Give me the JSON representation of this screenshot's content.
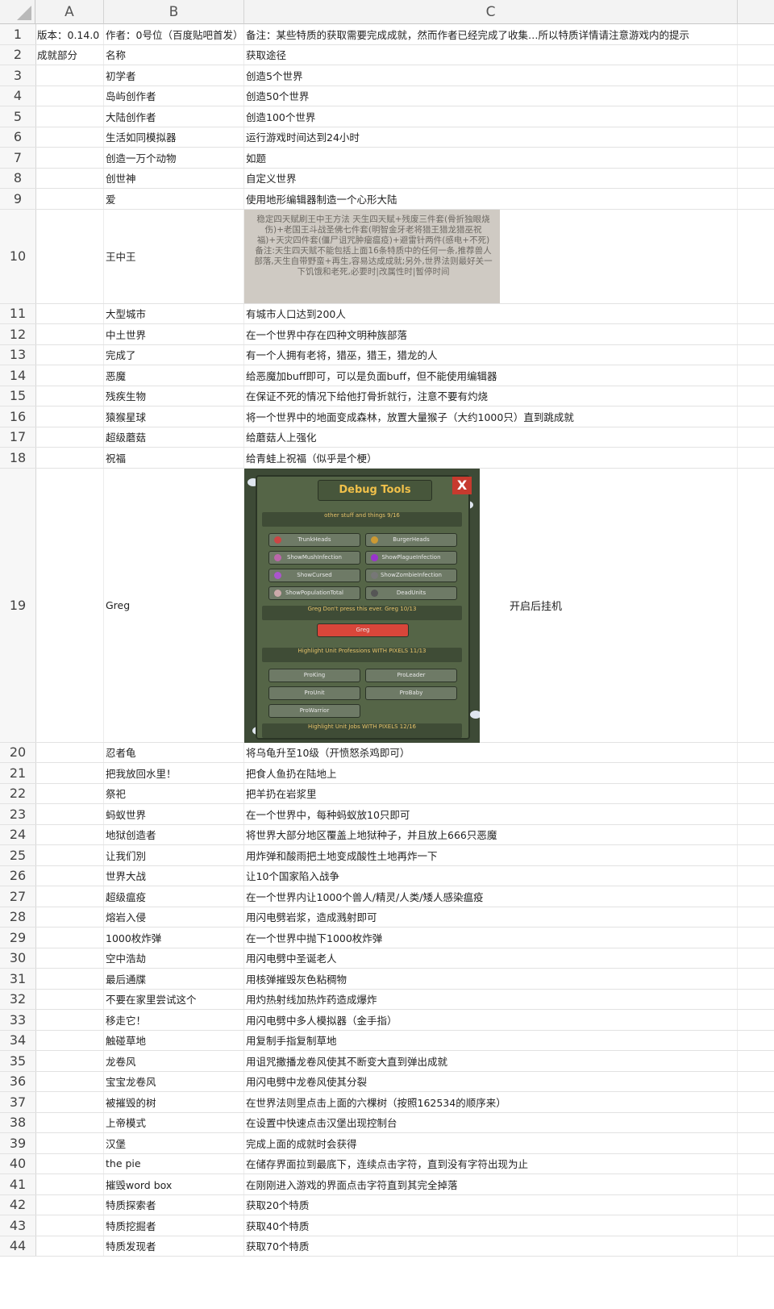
{
  "columns": [
    "A",
    "B",
    "C"
  ],
  "rows": [
    {
      "n": "1",
      "a": "版本：0.14.0",
      "b": "作者：0号位（百度贴吧首发）",
      "c": "备注：某些特质的获取需要完成成就，然而作者已经完成了收集…所以特质详情请注意游戏内的提示"
    },
    {
      "n": "2",
      "a": "成就部分",
      "b": "名称",
      "c": "获取途径"
    },
    {
      "n": "3",
      "a": "",
      "b": "初学者",
      "c": "创造5个世界"
    },
    {
      "n": "4",
      "a": "",
      "b": "岛屿创作者",
      "c": "创造50个世界"
    },
    {
      "n": "5",
      "a": "",
      "b": "大陆创作者",
      "c": "创造100个世界"
    },
    {
      "n": "6",
      "a": "",
      "b": "生活如同模拟器",
      "c": "运行游戏时间达到24小时"
    },
    {
      "n": "7",
      "a": "",
      "b": "创造一万个动物",
      "c": "如题"
    },
    {
      "n": "8",
      "a": "",
      "b": "创世神",
      "c": "自定义世界"
    },
    {
      "n": "9",
      "a": "",
      "b": "爱",
      "c": "使用地形编辑器制造一个心形大陆"
    },
    {
      "n": "10",
      "a": "",
      "b": "王中王",
      "c": ""
    },
    {
      "n": "11",
      "a": "",
      "b": "大型城市",
      "c": "有城市人口达到200人"
    },
    {
      "n": "12",
      "a": "",
      "b": "中土世界",
      "c": "在一个世界中存在四种文明种族部落"
    },
    {
      "n": "13",
      "a": "",
      "b": "完成了",
      "c": "有一个人拥有老将，猎巫，猎王，猎龙的人"
    },
    {
      "n": "14",
      "a": "",
      "b": "恶魔",
      "c": "给恶魔加buff即可，可以是负面buff，但不能使用编辑器"
    },
    {
      "n": "15",
      "a": "",
      "b": "残疾生物",
      "c": "在保证不死的情况下给他打骨折就行，注意不要有灼烧"
    },
    {
      "n": "16",
      "a": "",
      "b": "猿猴星球",
      "c": "将一个世界中的地面变成森林，放置大量猴子（大约1000只）直到跳成就"
    },
    {
      "n": "17",
      "a": "",
      "b": "超级蘑菇",
      "c": "给蘑菇人上强化"
    },
    {
      "n": "18",
      "a": "",
      "b": "祝福",
      "c": "给青蛙上祝福（似乎是个梗）"
    },
    {
      "n": "19",
      "a": "",
      "b": "Greg",
      "c": "",
      "d": "开启后挂机"
    },
    {
      "n": "20",
      "a": "",
      "b": "忍者龟",
      "c": "将乌龟升至10级（开愤怒杀鸡即可）"
    },
    {
      "n": "21",
      "a": "",
      "b": "把我放回水里！",
      "c": "把食人鱼扔在陆地上"
    },
    {
      "n": "22",
      "a": "",
      "b": "祭祀",
      "c": "把羊扔在岩浆里"
    },
    {
      "n": "23",
      "a": "",
      "b": "蚂蚁世界",
      "c": "在一个世界中，每种蚂蚁放10只即可"
    },
    {
      "n": "24",
      "a": "",
      "b": "地狱创造者",
      "c": "将世界大部分地区覆盖上地狱种子，并且放上666只恶魔"
    },
    {
      "n": "25",
      "a": "",
      "b": "让我们別",
      "c": "用炸弹和酸雨把土地变成酸性土地再炸一下"
    },
    {
      "n": "26",
      "a": "",
      "b": "世界大战",
      "c": "让10个国家陷入战争"
    },
    {
      "n": "27",
      "a": "",
      "b": "超级瘟疫",
      "c": "在一个世界内让1000个兽人/精灵/人类/矮人感染瘟疫"
    },
    {
      "n": "28",
      "a": "",
      "b": "熔岩入侵",
      "c": "用闪电劈岩浆，造成溅射即可"
    },
    {
      "n": "29",
      "a": "",
      "b": "1000枚炸弹",
      "c": "在一个世界中抛下1000枚炸弹"
    },
    {
      "n": "30",
      "a": "",
      "b": "空中浩劫",
      "c": "用闪电劈中圣诞老人"
    },
    {
      "n": "31",
      "a": "",
      "b": "最后通牒",
      "c": "用核弹摧毁灰色粘稠物"
    },
    {
      "n": "32",
      "a": "",
      "b": "不要在家里尝试这个",
      "c": "用灼热射线加热炸药造成爆炸"
    },
    {
      "n": "33",
      "a": "",
      "b": "移走它！",
      "c": "用闪电劈中多人模拟器（金手指）"
    },
    {
      "n": "34",
      "a": "",
      "b": "触碰草地",
      "c": "用复制手指复制草地"
    },
    {
      "n": "35",
      "a": "",
      "b": "龙卷风",
      "c": "用诅咒撒播龙卷风使其不断变大直到弹出成就"
    },
    {
      "n": "36",
      "a": "",
      "b": "宝宝龙卷风",
      "c": "用闪电劈中龙卷风使其分裂"
    },
    {
      "n": "37",
      "a": "",
      "b": "被摧毁的树",
      "c": "在世界法则里点击上面的六棵树（按照162534的顺序来）"
    },
    {
      "n": "38",
      "a": "",
      "b": "上帝模式",
      "c": "在设置中快速点击汉堡出现控制台"
    },
    {
      "n": "39",
      "a": "",
      "b": "汉堡",
      "c": "完成上面的成就时会获得"
    },
    {
      "n": "40",
      "a": "",
      "b": "the pie",
      "c": "在储存界面拉到最底下，连续点击字符，直到没有字符出现为止"
    },
    {
      "n": "41",
      "a": "",
      "b": "摧毁word box",
      "c": "在刚刚进入游戏的界面点击字符直到其完全掉落"
    },
    {
      "n": "42",
      "a": "",
      "b": "特质探索者",
      "c": "获取20个特质"
    },
    {
      "n": "43",
      "a": "",
      "b": "特质挖掘者",
      "c": "获取40个特质"
    },
    {
      "n": "44",
      "a": "",
      "b": "特质发现者",
      "c": "获取70个特质"
    }
  ],
  "row10_image_text": "稳定四天赋刷王中王方法\n天生四天赋+残废三件套(骨折独眼烧伤)+老国王斗战圣佛七件套(明智金牙老将猎王猎龙猎巫祝福)+天灾四件套(僵尸诅咒肿瘤瘟疫)+避雷针两件(感电+不死)\n备注:天生四天赋不能包括上面16条特质中的任何一条,推荐兽人部落,天生自带野蛮+再生,容易达成成就;另外,世界法则最好关一下饥饿和老死,必要时|改属性时|暂停时间",
  "debug_tools": {
    "title": "Debug Tools",
    "close": "X",
    "section1": "other stuff and things",
    "section1_count": "9/16",
    "buttons1": [
      "TrunkHeads",
      "BurgerHeads",
      "ShowMushInfection",
      "ShowPlagueInfection",
      "ShowCursed",
      "ShowZombieInfection",
      "ShowPopulationTotal",
      "DeadUnits"
    ],
    "section2": "Greg Don't press this ever. Greg",
    "section2_count": "10/13",
    "greg_button": "Greg",
    "section3": "Highlight Unit Professions WITH PIXELS",
    "section3_count": "11/13",
    "buttons3": [
      "ProKing",
      "ProLeader",
      "ProUnit",
      "ProBaby",
      "ProWarrior"
    ],
    "section4": "Highlight Unit Jobs WITH PIXELS",
    "section4_count": "12/16"
  }
}
